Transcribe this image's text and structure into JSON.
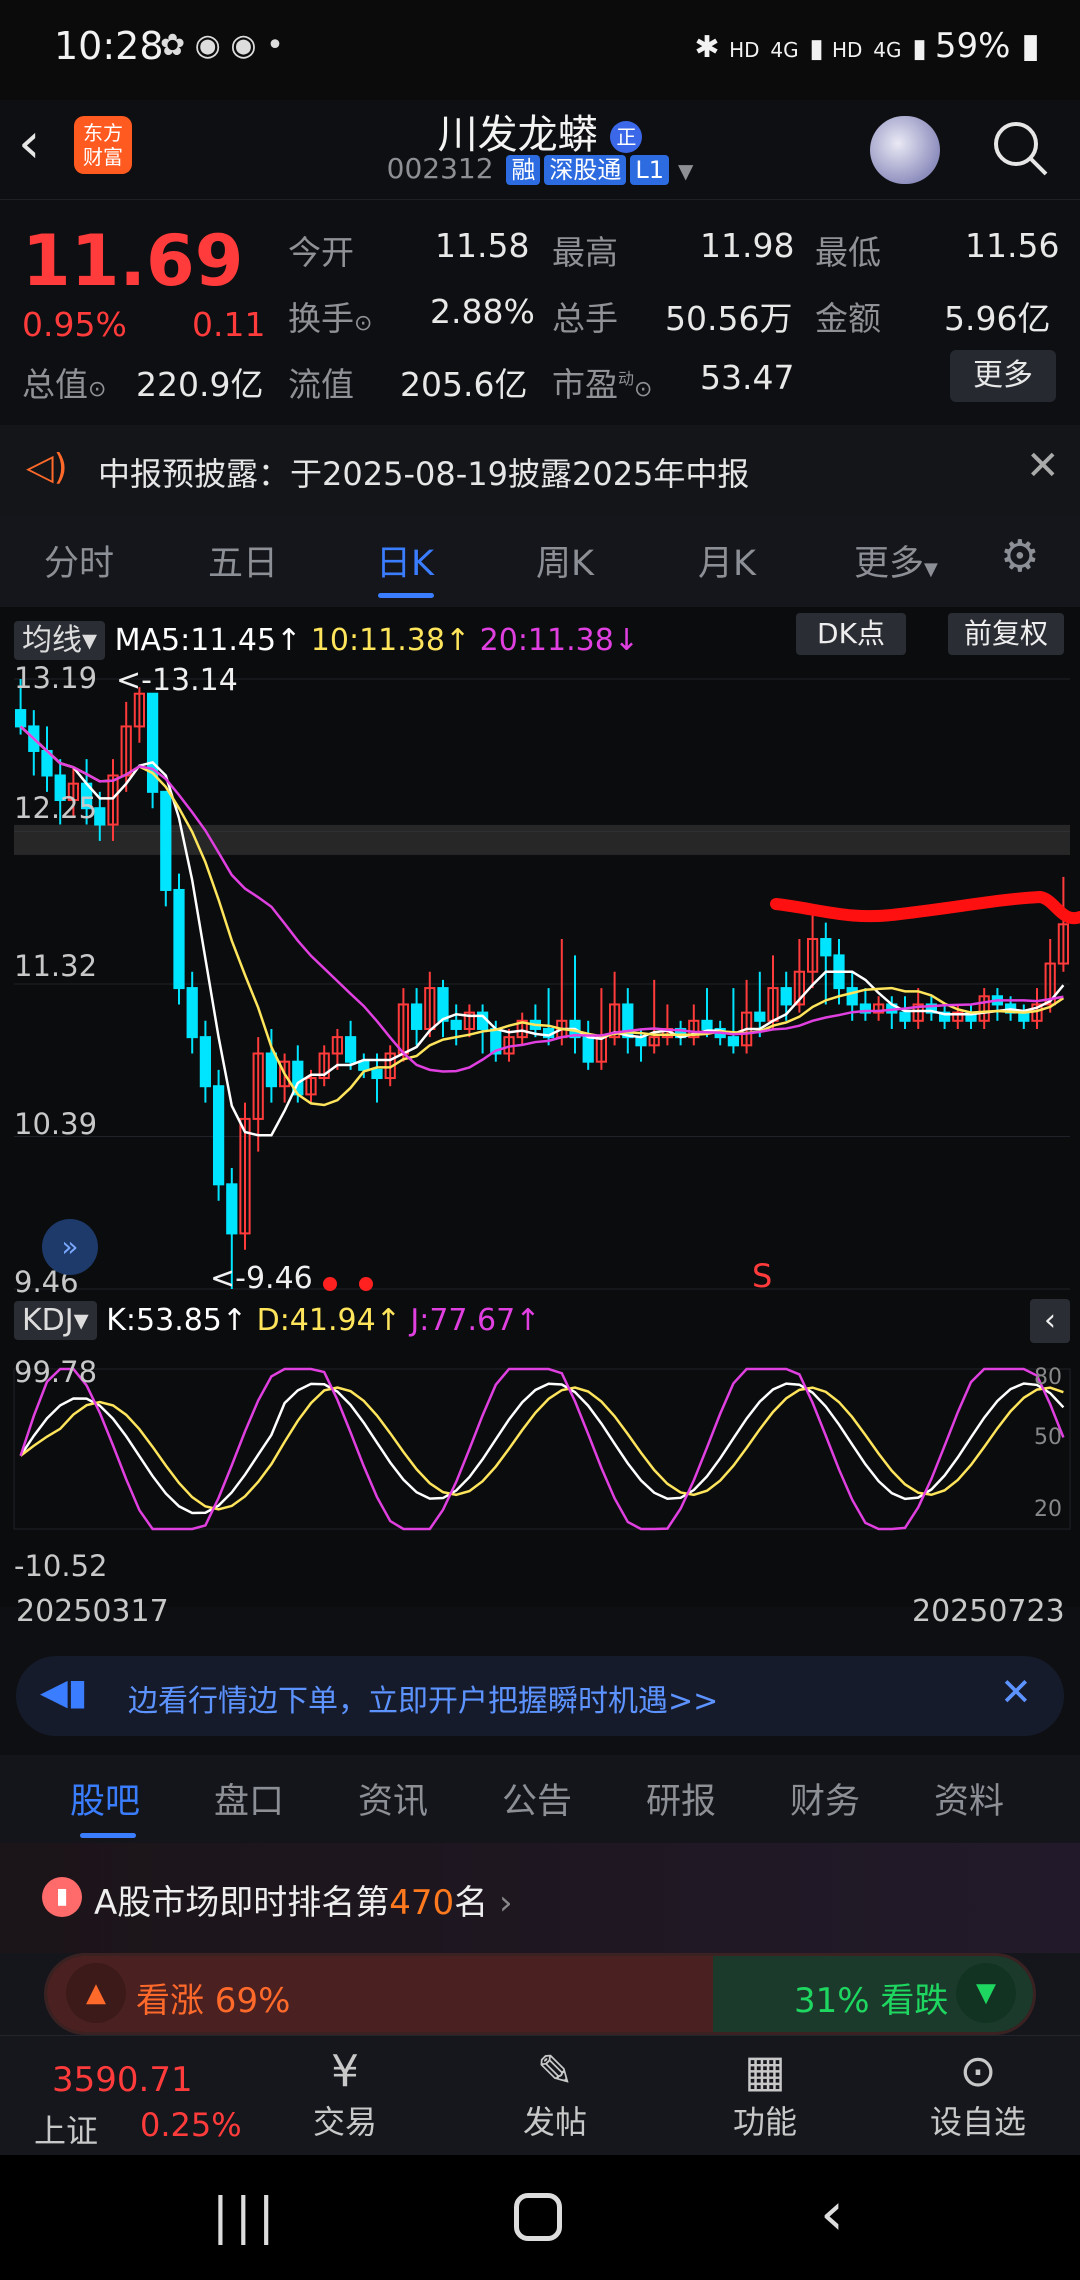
{
  "status_bar": {
    "time": "10:28",
    "battery": "59%",
    "net_a": "HD",
    "net_b": "4G",
    "net_c": "HD",
    "net_d": "4G"
  },
  "header": {
    "title": "川发龙蟒",
    "title_badge": "正",
    "code": "002312",
    "tags": [
      "融",
      "深股通",
      "L1"
    ],
    "logo_text": "东方财富"
  },
  "quote": {
    "price": "11.69",
    "change_pct": "0.95%",
    "change": "0.11",
    "rows": [
      [
        {
          "label": "今开",
          "value": "11.58",
          "color": "#e8e8e8"
        },
        {
          "label": "最高",
          "value": "11.98",
          "color": "#ff3b3b"
        },
        {
          "label": "最低",
          "value": "11.56",
          "color": "#1ed760"
        }
      ],
      [
        {
          "label": "换手",
          "value": "2.88%",
          "color": "#e8e8e8"
        },
        {
          "label": "总手",
          "value": "50.56万",
          "color": "#e8e8e8"
        },
        {
          "label": "金额",
          "value": "5.96亿",
          "color": "#e8e8e8"
        }
      ],
      [
        {
          "label": "总值",
          "value": "220.9亿",
          "color": "#e8e8e8"
        },
        {
          "label": "流值",
          "value": "205.6亿",
          "color": "#e8e8e8"
        },
        {
          "label": "市盈",
          "value": "53.47",
          "color": "#e8e8e8"
        }
      ]
    ],
    "pe_sup": "动",
    "more_btn": "更多"
  },
  "notice": {
    "text": "中报预披露：于2025-08-19披露2025年中报"
  },
  "tabs": [
    "分时",
    "五日",
    "日K",
    "周K",
    "月K",
    "更多"
  ],
  "active_tab": 2,
  "ma_bar": {
    "selector": "均线",
    "ma5": "MA5:11.45",
    "ma10": "10:11.38",
    "ma20": "20:11.38",
    "dk_btn": "DK点",
    "fq_btn": "前复权"
  },
  "price_axis": [
    "13.19",
    "12.25",
    "11.32",
    "10.39",
    "9.46"
  ],
  "annotations": {
    "high": "<-13.14",
    "low": "<-9.46",
    "signal": "S"
  },
  "kdj_bar": {
    "selector": "KDJ",
    "k": "K:53.85",
    "d": "D:41.94",
    "j": "J:77.67"
  },
  "kdj_axis": {
    "top": "99.78",
    "bottom": "-10.52",
    "r80": "80",
    "r50": "50",
    "r20": "20"
  },
  "dates": {
    "start": "20250317",
    "end": "20250723"
  },
  "promo": {
    "text": "边看行情边下单，立即开户把握瞬时机遇>>"
  },
  "bottom_tabs": [
    "股吧",
    "盘口",
    "资讯",
    "公告",
    "研报",
    "财务",
    "资料"
  ],
  "rank": {
    "prefix": "A股市场即时排名第",
    "num": "470",
    "suffix": "名"
  },
  "sentiment": {
    "up": "看涨 69%",
    "down": "31% 看跌",
    "up_pct": 69
  },
  "navbar": {
    "index_value": "3590.71",
    "index_name": "上证",
    "index_pct": "0.25%",
    "items": [
      "交易",
      "发帖",
      "功能",
      "设自选"
    ]
  },
  "colors": {
    "up": "#ff3b3b",
    "down": "#00e5ff",
    "ma5": "#ffffff",
    "ma10": "#ffe55c",
    "ma20": "#e040e0",
    "accent": "#3a7dff"
  },
  "chart_data": {
    "type": "candlestick",
    "price_range": [
      9.46,
      13.19
    ],
    "candles": [
      [
        13.0,
        12.9,
        13.19,
        12.85
      ],
      [
        12.9,
        12.75,
        13.0,
        12.6
      ],
      [
        12.75,
        12.6,
        12.9,
        12.5
      ],
      [
        12.6,
        12.45,
        12.7,
        12.3
      ],
      [
        12.45,
        12.55,
        12.65,
        12.35
      ],
      [
        12.55,
        12.4,
        12.7,
        12.3
      ],
      [
        12.4,
        12.3,
        12.5,
        12.2
      ],
      [
        12.3,
        12.6,
        12.7,
        12.2
      ],
      [
        12.6,
        12.9,
        13.05,
        12.5
      ],
      [
        12.9,
        13.1,
        13.14,
        12.8
      ],
      [
        13.1,
        12.5,
        13.1,
        12.4
      ],
      [
        12.5,
        11.9,
        12.5,
        11.8
      ],
      [
        11.9,
        11.3,
        12.0,
        11.2
      ],
      [
        11.3,
        11.0,
        11.4,
        10.9
      ],
      [
        11.0,
        10.7,
        11.1,
        10.6
      ],
      [
        10.7,
        10.1,
        10.8,
        10.0
      ],
      [
        10.1,
        9.8,
        10.2,
        9.46
      ],
      [
        9.8,
        10.5,
        10.6,
        9.7
      ],
      [
        10.5,
        10.9,
        11.0,
        10.3
      ],
      [
        10.9,
        10.7,
        11.05,
        10.6
      ],
      [
        10.7,
        10.85,
        10.9,
        10.6
      ],
      [
        10.85,
        10.65,
        10.95,
        10.6
      ],
      [
        10.65,
        10.75,
        10.8,
        10.6
      ],
      [
        10.75,
        10.9,
        10.95,
        10.7
      ],
      [
        10.9,
        11.0,
        11.05,
        10.8
      ],
      [
        11.0,
        10.85,
        11.1,
        10.8
      ],
      [
        10.85,
        10.8,
        10.9,
        10.75
      ],
      [
        10.8,
        10.75,
        10.9,
        10.6
      ],
      [
        10.75,
        10.9,
        10.95,
        10.7
      ],
      [
        10.9,
        11.2,
        11.3,
        10.85
      ],
      [
        11.2,
        11.05,
        11.3,
        10.95
      ],
      [
        11.05,
        11.3,
        11.4,
        11.0
      ],
      [
        11.3,
        11.1,
        11.35,
        11.0
      ],
      [
        11.1,
        11.05,
        11.2,
        10.95
      ],
      [
        11.05,
        11.15,
        11.2,
        11.0
      ],
      [
        11.15,
        11.05,
        11.2,
        10.9
      ],
      [
        11.05,
        10.9,
        11.1,
        10.85
      ],
      [
        10.9,
        11.0,
        11.05,
        10.85
      ],
      [
        11.0,
        11.1,
        11.15,
        10.95
      ],
      [
        11.1,
        11.05,
        11.2,
        11.0
      ],
      [
        11.05,
        11.0,
        11.3,
        10.95
      ],
      [
        11.0,
        11.1,
        11.6,
        10.95
      ],
      [
        11.1,
        11.0,
        11.5,
        10.9
      ],
      [
        11.0,
        10.85,
        11.1,
        10.8
      ],
      [
        10.85,
        11.0,
        11.3,
        10.8
      ],
      [
        11.0,
        11.2,
        11.4,
        10.95
      ],
      [
        11.2,
        11.0,
        11.3,
        10.9
      ],
      [
        11.0,
        10.95,
        11.05,
        10.85
      ],
      [
        10.95,
        11.0,
        11.35,
        10.9
      ],
      [
        11.0,
        11.05,
        11.2,
        10.95
      ],
      [
        11.05,
        11.0,
        11.1,
        10.95
      ],
      [
        11.0,
        11.1,
        11.2,
        10.95
      ],
      [
        11.1,
        11.05,
        11.3,
        11.0
      ],
      [
        11.05,
        11.0,
        11.1,
        10.95
      ],
      [
        11.0,
        10.95,
        11.3,
        10.9
      ],
      [
        10.95,
        11.15,
        11.35,
        10.9
      ],
      [
        11.15,
        11.1,
        11.4,
        11.0
      ],
      [
        11.1,
        11.3,
        11.5,
        11.05
      ],
      [
        11.3,
        11.2,
        11.4,
        11.1
      ],
      [
        11.2,
        11.4,
        11.6,
        11.15
      ],
      [
        11.4,
        11.6,
        11.75,
        11.3
      ],
      [
        11.6,
        11.5,
        11.7,
        11.2
      ],
      [
        11.5,
        11.3,
        11.6,
        11.2
      ],
      [
        11.3,
        11.2,
        11.4,
        11.1
      ],
      [
        11.2,
        11.15,
        11.3,
        11.1
      ],
      [
        11.15,
        11.2,
        11.25,
        11.1
      ],
      [
        11.2,
        11.15,
        11.25,
        11.05
      ],
      [
        11.15,
        11.1,
        11.25,
        11.05
      ],
      [
        11.1,
        11.2,
        11.3,
        11.05
      ],
      [
        11.2,
        11.15,
        11.25,
        11.1
      ],
      [
        11.15,
        11.1,
        11.2,
        11.05
      ],
      [
        11.1,
        11.15,
        11.2,
        11.05
      ],
      [
        11.15,
        11.1,
        11.2,
        11.05
      ],
      [
        11.1,
        11.25,
        11.3,
        11.05
      ],
      [
        11.25,
        11.2,
        11.3,
        11.1
      ],
      [
        11.2,
        11.15,
        11.25,
        11.1
      ],
      [
        11.15,
        11.1,
        11.2,
        11.05
      ],
      [
        11.1,
        11.2,
        11.3,
        11.05
      ],
      [
        11.2,
        11.45,
        11.6,
        11.15
      ],
      [
        11.45,
        11.69,
        11.98,
        11.4
      ]
    ]
  }
}
